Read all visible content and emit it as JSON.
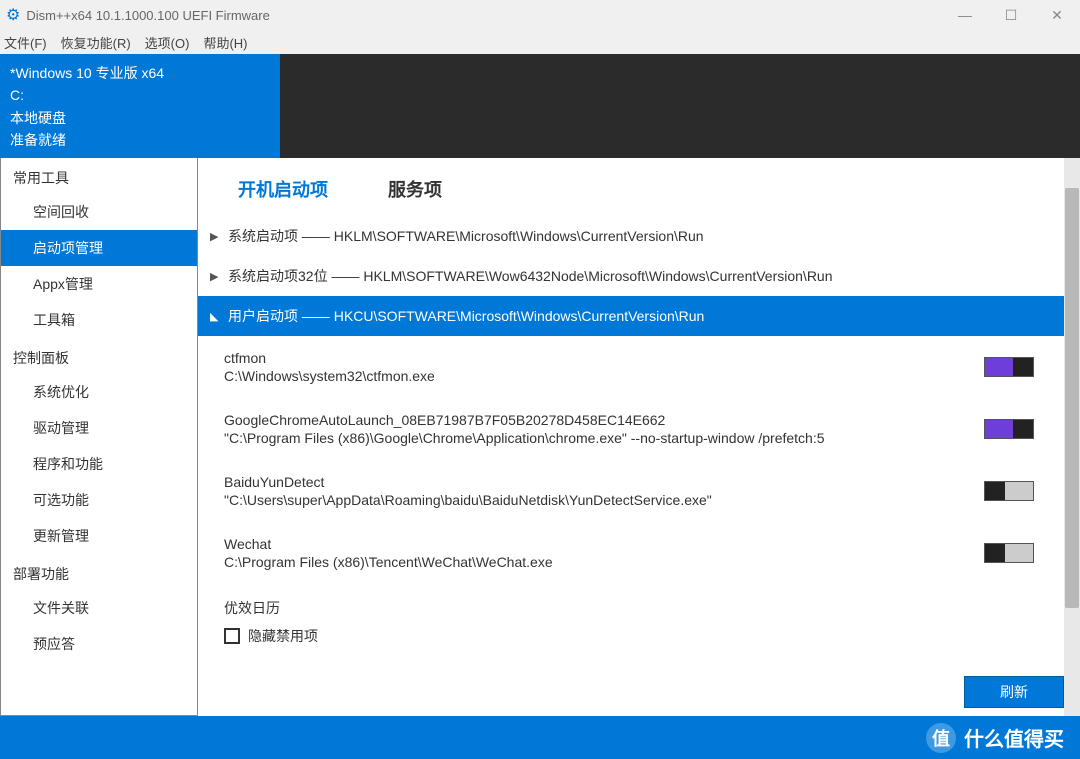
{
  "title": "Dism++x64 10.1.1000.100 UEFI Firmware",
  "menu": {
    "file": "文件(F)",
    "recovery": "恢复功能(R)",
    "options": "选项(O)",
    "help": "帮助(H)"
  },
  "info": {
    "l1": "*Windows 10 专业版 x64",
    "l2": "C:",
    "l3": "本地硬盘",
    "l4": "准备就绪"
  },
  "sidebar": {
    "g1": "常用工具",
    "i1": "空间回收",
    "i2": "启动项管理",
    "i3": "Appx管理",
    "i4": "工具箱",
    "g2": "控制面板",
    "i5": "系统优化",
    "i6": "驱动管理",
    "i7": "程序和功能",
    "i8": "可选功能",
    "i9": "更新管理",
    "g3": "部署功能",
    "i10": "文件关联",
    "i11": "预应答"
  },
  "tabs": {
    "startup": "开机启动项",
    "services": "服务项"
  },
  "groups": {
    "sys": "系统启动项 —— HKLM\\SOFTWARE\\Microsoft\\Windows\\CurrentVersion\\Run",
    "sys32": "系统启动项32位 —— HKLM\\SOFTWARE\\Wow6432Node\\Microsoft\\Windows\\CurrentVersion\\Run",
    "user": "用户启动项 —— HKCU\\SOFTWARE\\Microsoft\\Windows\\CurrentVersion\\Run"
  },
  "entries": {
    "e1n": "ctfmon",
    "e1p": "C:\\Windows\\system32\\ctfmon.exe",
    "e2n": "GoogleChromeAutoLaunch_08EB71987B7F05B20278D458EC14E662",
    "e2p": "\"C:\\Program Files (x86)\\Google\\Chrome\\Application\\chrome.exe\" --no-startup-window /prefetch:5",
    "e3n": "BaiduYunDetect",
    "e3p": "\"C:\\Users\\super\\AppData\\Roaming\\baidu\\BaiduNetdisk\\YunDetectService.exe\"",
    "e4n": "Wechat",
    "e4p": "C:\\Program Files (x86)\\Tencent\\WeChat\\WeChat.exe",
    "e5n": "优效日历"
  },
  "hide_disabled": "隐藏禁用项",
  "refresh": "刷新",
  "footer": "什么值得买",
  "footer_badge": "值"
}
